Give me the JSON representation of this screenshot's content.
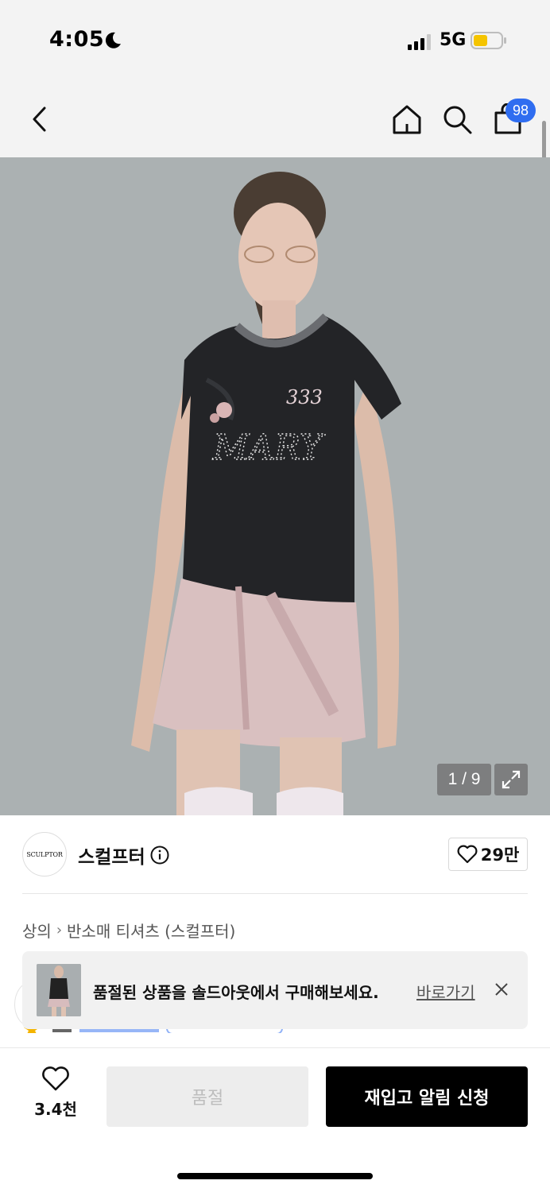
{
  "status_bar": {
    "time": "4:05",
    "network": "5G",
    "battery_color": "#f5c400"
  },
  "header": {
    "cart_badge": "98",
    "icons": [
      "back-icon",
      "home-icon",
      "search-icon",
      "bag-icon"
    ]
  },
  "gallery": {
    "page_indicator": "1 / 9",
    "expand_icon": "expand-icon"
  },
  "brand": {
    "logo_text": "SCULPTOR",
    "name": "스컬프터",
    "like_count": "29만"
  },
  "breadcrumb": {
    "items": [
      "상의",
      "반소매 티셔츠 (스컬프터)"
    ]
  },
  "banner": {
    "message": "품절된 상품을 솔드아웃에서 구매해보세요.",
    "link": "바로가기"
  },
  "bottom_bar": {
    "wish_count": "3.4천",
    "soldout_label": "품절",
    "restock_label": "재입고 알림 신청"
  },
  "colors": {
    "accent_blue": "#2f6df0",
    "primary_black": "#000000",
    "disabled_gray": "#ededed"
  }
}
